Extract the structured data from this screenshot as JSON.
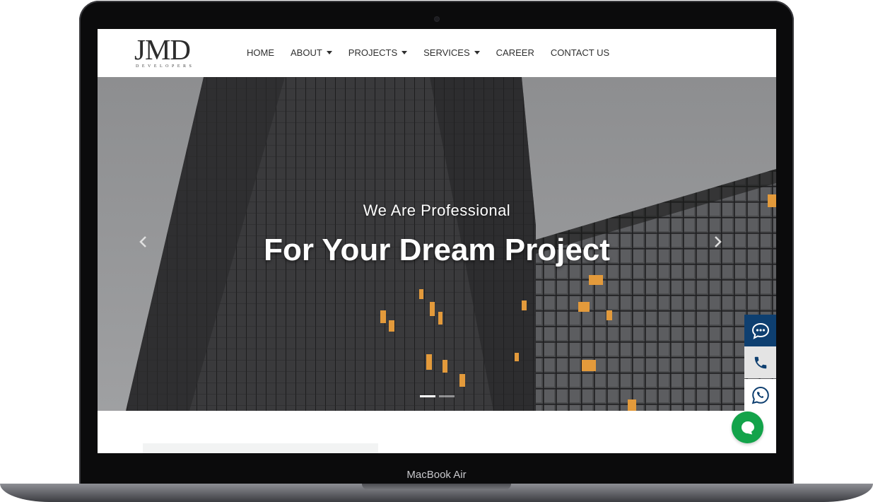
{
  "device": {
    "label": "MacBook Air"
  },
  "logo": {
    "main": "JMD",
    "sub": "DEVELOPERS"
  },
  "nav": [
    {
      "label": "HOME",
      "dropdown": false
    },
    {
      "label": "ABOUT",
      "dropdown": true
    },
    {
      "label": "PROJECTS",
      "dropdown": true
    },
    {
      "label": "SERVICES",
      "dropdown": true
    },
    {
      "label": "CAREER",
      "dropdown": false
    },
    {
      "label": "CONTACT US",
      "dropdown": false
    }
  ],
  "hero": {
    "subtitle": "We Are Professional",
    "title": "For Your Dream Project",
    "slide_count": 2,
    "active_slide": 1
  },
  "icons": {
    "prev": "chevron-left-icon",
    "next": "chevron-right-icon",
    "chat": "message-dots-icon",
    "phone": "phone-icon",
    "whatsapp": "whatsapp-icon",
    "live_chat": "chat-bubble-icon"
  },
  "colors": {
    "chat_button": "#0e3f70",
    "phone_button": "#e4e4e4",
    "whatsapp_button": "#ffffff",
    "live_chat": "#13a34a",
    "window_light": "#e39a3b"
  }
}
